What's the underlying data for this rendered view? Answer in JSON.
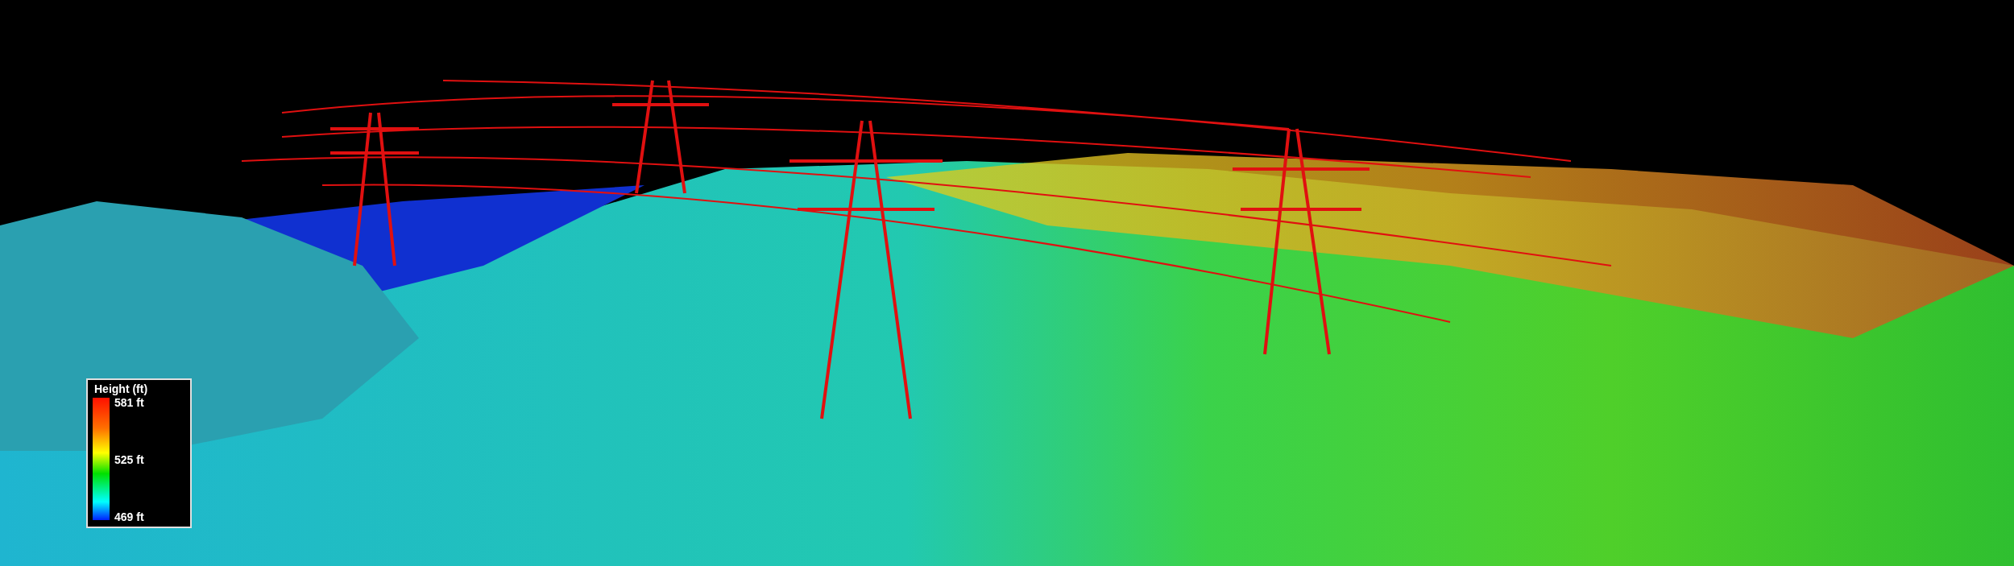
{
  "legend": {
    "title": "Height (ft)",
    "ticks": [
      "581 ft",
      "525 ft",
      "469 ft"
    ]
  }
}
